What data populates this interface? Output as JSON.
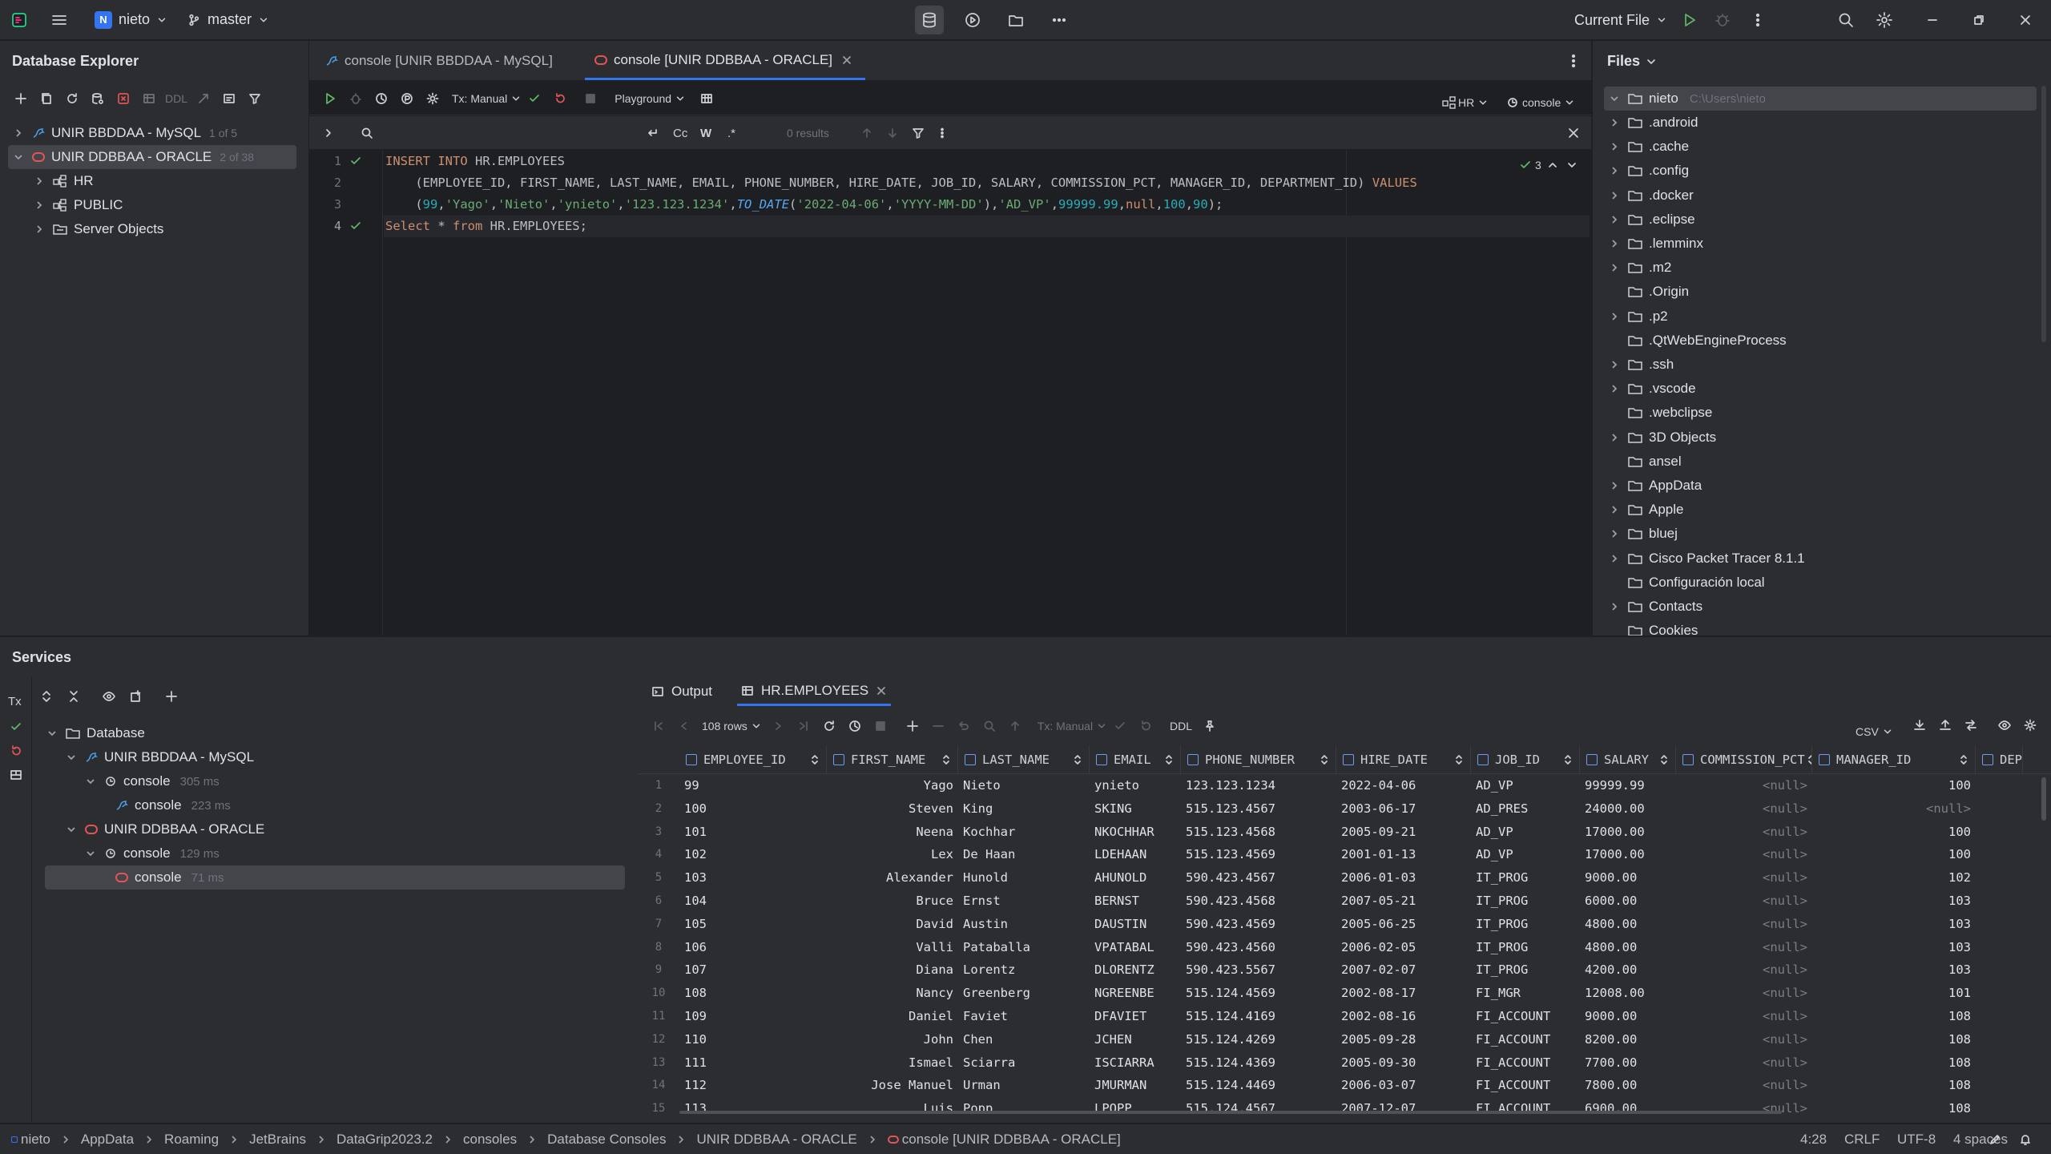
{
  "titlebar": {
    "project": "nieto",
    "project_initial": "N",
    "branch": "master",
    "run_config": "Current File"
  },
  "db_explorer": {
    "title": "Database Explorer",
    "toolbar_ddl": "DDL",
    "connections": [
      {
        "label": "UNIR BBDDAA - MySQL",
        "meta": "1 of 5"
      },
      {
        "label": "UNIR DDBBAA - ORACLE",
        "meta": "2 of 38"
      }
    ],
    "children": [
      "HR",
      "PUBLIC",
      "Server Objects"
    ]
  },
  "editor": {
    "tabs": [
      {
        "label": "console [UNIR BBDDAA - MySQL]"
      },
      {
        "label": "console [UNIR DDBBAA - ORACLE]"
      }
    ],
    "tx_mode": "Tx: Manual",
    "playground": "Playground",
    "schema": "HR",
    "session": "console",
    "find_results": "0 results",
    "find_options": {
      "case": "Cc",
      "word": "W",
      "regex": ".*"
    },
    "inspections": "3",
    "line_numbers": [
      "1",
      "2",
      "3",
      "4"
    ],
    "lines": [
      "INSERT INTO HR.EMPLOYEES",
      "    (EMPLOYEE_ID, FIRST_NAME, LAST_NAME, EMAIL, PHONE_NUMBER, HIRE_DATE, JOB_ID, SALARY, COMMISSION_PCT, MANAGER_ID, DEPARTMENT_ID) VALUES",
      "    (99,'Yago','Nieto','ynieto','123.123.1234',TO_DATE('2022-04-06','YYYY-MM-DD'),'AD_VP',99999.99,null,100,90);",
      "Select * from HR.EMPLOYEES;"
    ]
  },
  "files": {
    "title": "Files",
    "root": {
      "name": "nieto",
      "path": "C:\\Users\\nieto"
    },
    "items": [
      {
        "name": ".android",
        "exp": true
      },
      {
        "name": ".cache",
        "exp": true
      },
      {
        "name": ".config",
        "exp": true
      },
      {
        "name": ".docker",
        "exp": true
      },
      {
        "name": ".eclipse",
        "exp": true
      },
      {
        "name": ".lemminx",
        "exp": true
      },
      {
        "name": ".m2",
        "exp": true
      },
      {
        "name": ".Origin",
        "exp": false
      },
      {
        "name": ".p2",
        "exp": true
      },
      {
        "name": ".QtWebEngineProcess",
        "exp": false
      },
      {
        "name": ".ssh",
        "exp": true
      },
      {
        "name": ".vscode",
        "exp": true
      },
      {
        "name": ".webclipse",
        "exp": false
      },
      {
        "name": "3D Objects",
        "exp": true
      },
      {
        "name": "ansel",
        "exp": false
      },
      {
        "name": "AppData",
        "exp": true
      },
      {
        "name": "Apple",
        "exp": true
      },
      {
        "name": "bluej",
        "exp": true
      },
      {
        "name": "Cisco Packet Tracer 8.1.1",
        "exp": true
      },
      {
        "name": "Configuración local",
        "exp": false
      },
      {
        "name": "Contacts",
        "exp": true
      },
      {
        "name": "Cookies",
        "exp": false
      }
    ]
  },
  "services": {
    "title": "Services",
    "tx_label": "Tx",
    "tree": [
      {
        "label": "Database",
        "level": 0,
        "type": "folder"
      },
      {
        "label": "UNIR BBDDAA - MySQL",
        "level": 1,
        "type": "mysql"
      },
      {
        "label": "console",
        "meta": "305 ms",
        "level": 2,
        "type": "session"
      },
      {
        "label": "console",
        "meta": "223 ms",
        "level": 3,
        "type": "mysql"
      },
      {
        "label": "UNIR DDBBAA - ORACLE",
        "level": 1,
        "type": "oracle"
      },
      {
        "label": "console",
        "meta": "129 ms",
        "level": 2,
        "type": "session"
      },
      {
        "label": "console",
        "meta": "71 ms",
        "level": 3,
        "type": "oracle"
      }
    ]
  },
  "results": {
    "tabs": [
      "Output",
      "HR.EMPLOYEES"
    ],
    "rows_label": "108 rows",
    "tx_mode": "Tx: Manual",
    "ddl": "DDL",
    "export_format": "CSV",
    "columns": [
      "EMPLOYEE_ID",
      "FIRST_NAME",
      "LAST_NAME",
      "EMAIL",
      "PHONE_NUMBER",
      "HIRE_DATE",
      "JOB_ID",
      "SALARY",
      "COMMISSION_PCT",
      "MANAGER_ID",
      "DEP"
    ],
    "rows": [
      [
        "1",
        "99",
        "Yago",
        "Nieto",
        "ynieto",
        "123.123.1234",
        "2022-04-06",
        "AD_VP",
        "99999.99",
        "<null>",
        "100"
      ],
      [
        "2",
        "100",
        "Steven",
        "King",
        "SKING",
        "515.123.4567",
        "2003-06-17",
        "AD_PRES",
        "24000.00",
        "<null>",
        "<null>"
      ],
      [
        "3",
        "101",
        "Neena",
        "Kochhar",
        "NKOCHHAR",
        "515.123.4568",
        "2005-09-21",
        "AD_VP",
        "17000.00",
        "<null>",
        "100"
      ],
      [
        "4",
        "102",
        "Lex",
        "De Haan",
        "LDEHAAN",
        "515.123.4569",
        "2001-01-13",
        "AD_VP",
        "17000.00",
        "<null>",
        "100"
      ],
      [
        "5",
        "103",
        "Alexander",
        "Hunold",
        "AHUNOLD",
        "590.423.4567",
        "2006-01-03",
        "IT_PROG",
        "9000.00",
        "<null>",
        "102"
      ],
      [
        "6",
        "104",
        "Bruce",
        "Ernst",
        "BERNST",
        "590.423.4568",
        "2007-05-21",
        "IT_PROG",
        "6000.00",
        "<null>",
        "103"
      ],
      [
        "7",
        "105",
        "David",
        "Austin",
        "DAUSTIN",
        "590.423.4569",
        "2005-06-25",
        "IT_PROG",
        "4800.00",
        "<null>",
        "103"
      ],
      [
        "8",
        "106",
        "Valli",
        "Pataballa",
        "VPATABAL",
        "590.423.4560",
        "2006-02-05",
        "IT_PROG",
        "4800.00",
        "<null>",
        "103"
      ],
      [
        "9",
        "107",
        "Diana",
        "Lorentz",
        "DLORENTZ",
        "590.423.5567",
        "2007-02-07",
        "IT_PROG",
        "4200.00",
        "<null>",
        "103"
      ],
      [
        "10",
        "108",
        "Nancy",
        "Greenberg",
        "NGREENBE",
        "515.124.4569",
        "2002-08-17",
        "FI_MGR",
        "12008.00",
        "<null>",
        "101"
      ],
      [
        "11",
        "109",
        "Daniel",
        "Faviet",
        "DFAVIET",
        "515.124.4169",
        "2002-08-16",
        "FI_ACCOUNT",
        "9000.00",
        "<null>",
        "108"
      ],
      [
        "12",
        "110",
        "John",
        "Chen",
        "JCHEN",
        "515.124.4269",
        "2005-09-28",
        "FI_ACCOUNT",
        "8200.00",
        "<null>",
        "108"
      ],
      [
        "13",
        "111",
        "Ismael",
        "Sciarra",
        "ISCIARRA",
        "515.124.4369",
        "2005-09-30",
        "FI_ACCOUNT",
        "7700.00",
        "<null>",
        "108"
      ],
      [
        "14",
        "112",
        "Jose Manuel",
        "Urman",
        "JMURMAN",
        "515.124.4469",
        "2006-03-07",
        "FI_ACCOUNT",
        "7800.00",
        "<null>",
        "108"
      ],
      [
        "15",
        "113",
        "Luis",
        "Popp",
        "LPOPP",
        "515.124.4567",
        "2007-12-07",
        "FI_ACCOUNT",
        "6900.00",
        "<null>",
        "108"
      ]
    ]
  },
  "status_bar": {
    "breadcrumbs": [
      "nieto",
      "AppData",
      "Roaming",
      "JetBrains",
      "DataGrip2023.2",
      "consoles",
      "Database Consoles",
      "UNIR DDBBAA - ORACLE",
      "console [UNIR DDBBAA - ORACLE]"
    ],
    "position": "4:28",
    "line_sep": "CRLF",
    "encoding": "UTF-8",
    "indent": "4 spaces"
  }
}
